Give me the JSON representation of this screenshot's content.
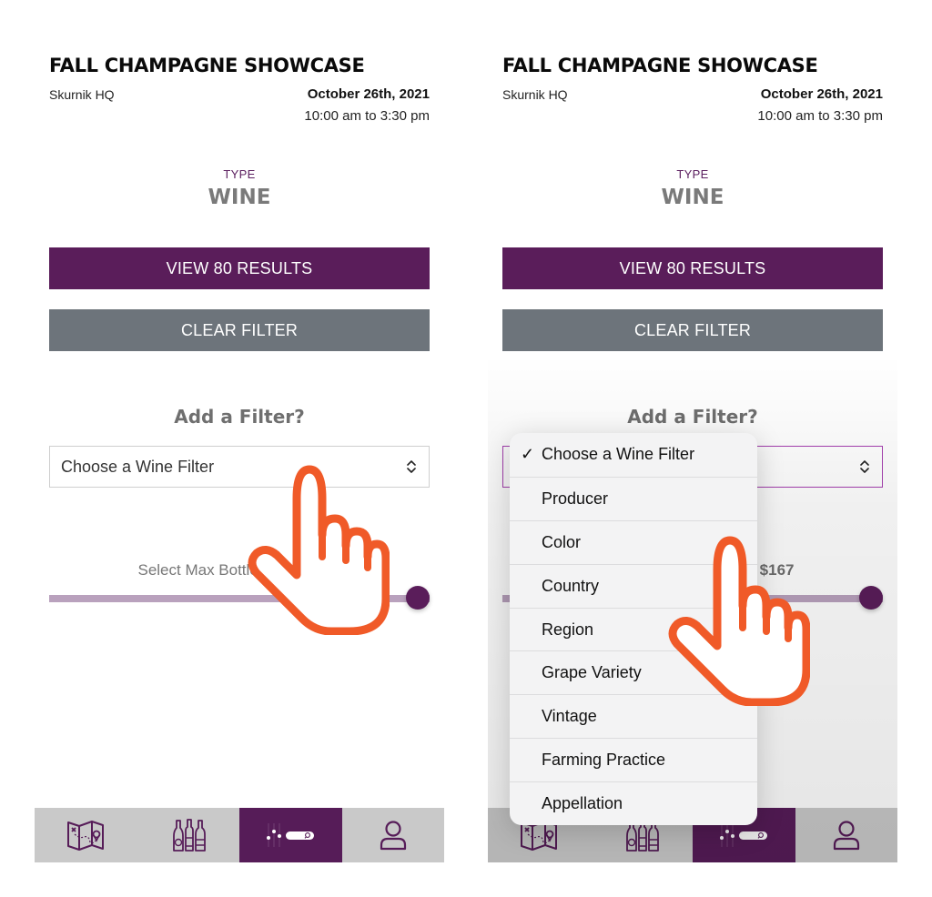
{
  "event": {
    "title": "FALL CHAMPAGNE SHOWCASE",
    "venue": "Skurnik HQ",
    "date": "October 26th, 2021",
    "time": "10:00 am to 3:30 pm"
  },
  "type": {
    "label": "TYPE",
    "value": "WINE"
  },
  "buttons": {
    "view_results": "VIEW 80 RESULTS",
    "clear_filter": "CLEAR FILTER"
  },
  "filter": {
    "heading": "Add a Filter?",
    "selected": "Choose a Wine Filter",
    "options": [
      {
        "label": "Choose a Wine Filter",
        "checked": true
      },
      {
        "label": "Producer",
        "checked": false
      },
      {
        "label": "Color",
        "checked": false
      },
      {
        "label": "Country",
        "checked": false
      },
      {
        "label": "Region",
        "checked": false
      },
      {
        "label": "Grape Variety",
        "checked": false
      },
      {
        "label": "Vintage",
        "checked": false
      },
      {
        "label": "Farming Practice",
        "checked": false
      },
      {
        "label": "Appellation",
        "checked": false
      }
    ],
    "check_glyph": "✓"
  },
  "slider": {
    "label": "Select Max Bottle Price: ",
    "value_text": "$167",
    "value_fraction": 1.0
  },
  "nav": {
    "items": [
      {
        "name": "map",
        "icon": "map-icon",
        "active": false
      },
      {
        "name": "wines",
        "icon": "bottles-icon",
        "active": false
      },
      {
        "name": "filter",
        "icon": "filter-search-icon",
        "active": true
      },
      {
        "name": "profile",
        "icon": "user-icon",
        "active": false
      }
    ]
  },
  "colors": {
    "brand_purple": "#5a1d5a",
    "clear_gray": "#6d747b",
    "slider_track": "#b9a1bd",
    "nav_bg": "#c9c9c9",
    "hand_orange": "#f05a28"
  }
}
